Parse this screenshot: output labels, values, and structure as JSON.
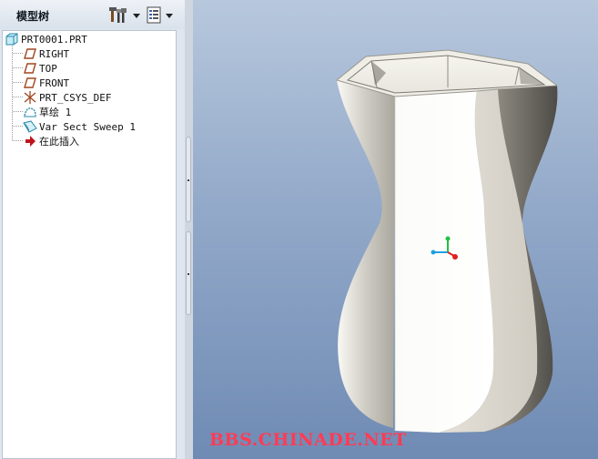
{
  "panel": {
    "title": "模型树",
    "buttons": [
      {
        "name": "tree-settings",
        "icon": "settings-tools-icon"
      },
      {
        "name": "tree-show",
        "icon": "show-filter-icon"
      }
    ]
  },
  "tree": {
    "items": [
      {
        "label": "PRT0001.PRT",
        "icon": "part-icon"
      },
      {
        "label": "RIGHT",
        "icon": "datum-plane-icon"
      },
      {
        "label": "TOP",
        "icon": "datum-plane-icon"
      },
      {
        "label": "FRONT",
        "icon": "datum-plane-icon"
      },
      {
        "label": "PRT_CSYS_DEF",
        "icon": "coordinate-system-icon"
      },
      {
        "label": "草绘 1",
        "icon": "sketch-icon"
      },
      {
        "label": "Var Sect Sweep 1",
        "icon": "sweep-feature-icon"
      },
      {
        "label": "在此插入",
        "icon": "insert-here-arrow-icon"
      }
    ]
  },
  "viewport": {
    "background_top": "#b7c8dd",
    "background_bottom": "#6f8bb4",
    "model": "vase-shaded-model",
    "triad_colors": {
      "x": "#e02020",
      "y": "#20c040",
      "z": "#20a0e0"
    }
  },
  "watermark": "BBS.CHINADE.NET"
}
